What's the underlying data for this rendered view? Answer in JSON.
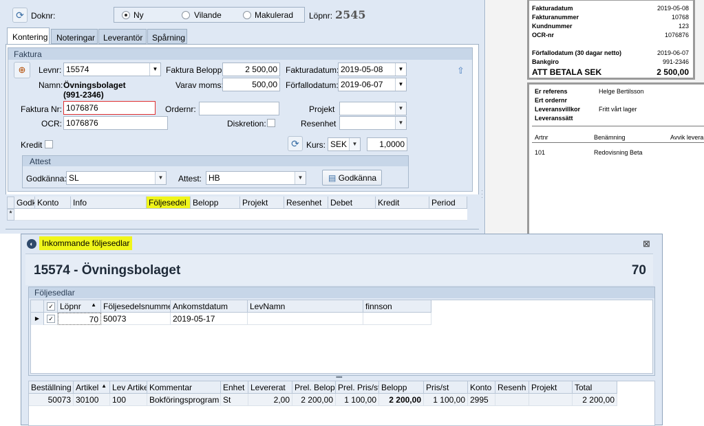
{
  "top": {
    "doknr_label": "Doknr:",
    "radio_ny": "Ny",
    "radio_vilande": "Vilande",
    "radio_makulerad": "Makulerad",
    "lopnr_label": "Löpnr:",
    "lopnr_value": "2545"
  },
  "tabs": [
    "Kontering",
    "Noteringar",
    "Leverantör",
    "Spårning"
  ],
  "faktura": {
    "group_title": "Faktura",
    "levnr_label": "Levnr:",
    "levnr_value": "15574",
    "namn_label": "Namn:",
    "namn_value": "Övningsbolaget",
    "namn_org": "(991-2346)",
    "belopp_label": "Faktura Belopp:",
    "belopp_value": "2 500,00",
    "moms_label": "Varav moms:",
    "moms_value": "500,00",
    "fakturadatum_label": "Fakturadatum:",
    "fakturadatum_value": "2019-05-08",
    "forfallodatum_label": "Förfallodatum:",
    "forfallodatum_value": "2019-06-07",
    "fakturanr_label": "Faktura Nr:",
    "fakturanr_value": "1076876",
    "ordernr_label": "Ordernr:",
    "ordernr_value": "",
    "projekt_label": "Projekt",
    "ocr_label": "OCR:",
    "ocr_value": "1076876",
    "diskretion_label": "Diskretion:",
    "resenhet_label": "Resenhet",
    "kredit_label": "Kredit",
    "kurs_label": "Kurs:",
    "currency": "SEK",
    "kurs_value": "1,0000"
  },
  "attest": {
    "group_title": "Attest",
    "godkanna_label": "Godkänna:",
    "godkanna_value": "SL",
    "attest_label": "Attest:",
    "attest_value": "HB",
    "button_label": "Godkänna"
  },
  "kontering_grid": {
    "columns": [
      "Godk",
      "Konto",
      "Info",
      "Följesedel",
      "Belopp",
      "Projekt",
      "Resenhet",
      "Debet",
      "Kredit",
      "Period"
    ],
    "new_row_marker": "*"
  },
  "right_panel": {
    "rows1": [
      [
        "Fakturadatum",
        "2019-05-08"
      ],
      [
        "Fakturanummer",
        "10768"
      ],
      [
        "Kundnummer",
        "123"
      ],
      [
        "OCR-nr",
        "1076876"
      ]
    ],
    "rows2": [
      [
        "Förfallodatum (30 dagar netto)",
        "2019-06-07"
      ],
      [
        "Bankgiro",
        "991-2346"
      ]
    ],
    "total_label": "ATT BETALA SEK",
    "total_value": "2 500,00",
    "refs": [
      [
        "Er referens",
        "Helge Bertilsson"
      ],
      [
        "Ert ordernr",
        ""
      ],
      [
        "Leveransvillkor",
        "Fritt vårt lager"
      ],
      [
        "Leveranssätt",
        ""
      ]
    ],
    "item_headers": [
      "Artnr",
      "Benämning",
      "Avvik leveran"
    ],
    "item_row": [
      "101",
      "Redovisning Beta"
    ]
  },
  "dialog": {
    "title": "Inkommande följesedlar",
    "header_text": "15574 - Övningsbolaget",
    "header_number": "70",
    "group_title": "Följesedlar",
    "upper_columns": [
      "Löpnr",
      "Följesedelsnummer",
      "Ankomstdatum",
      "LevNamn",
      "finnson"
    ],
    "upper_row": [
      "70",
      "50073",
      "2019-05-17",
      "",
      ""
    ],
    "lower_columns": [
      "Beställning",
      "Artikel",
      "Lev Artikel",
      "Kommentar",
      "Enhet",
      "Levererat",
      "Prel. Belopp",
      "Prel. Pris/st",
      "Belopp",
      "Pris/st",
      "Konto",
      "Resenh",
      "Projekt",
      "Total"
    ],
    "lower_row": [
      "50073",
      "30100",
      "100",
      "Bokföringsprogram",
      "St",
      "2,00",
      "2 200,00",
      "1 100,00",
      "2 200,00",
      "1 100,00",
      "2995",
      "",
      "",
      "2 200,00"
    ]
  },
  "colors": {
    "window_bg": "#dfe8f4",
    "highlight": "#f0f51a",
    "invalid_border": "#e03030",
    "grid_header": "#e8eef6"
  }
}
